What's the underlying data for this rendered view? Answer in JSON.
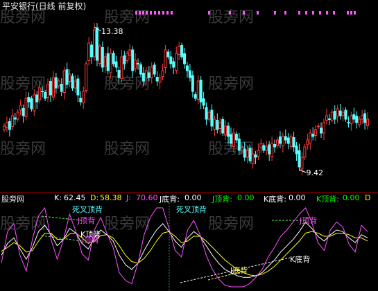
{
  "title": "平安银行(日线 前复权)",
  "watermark": "股旁网",
  "price_panel": {
    "high_label": "13.38",
    "low_label": "9.42"
  },
  "indicator_row": {
    "name": "股旁网",
    "k_label": "K:",
    "k_value": "62.45",
    "d_label": "D:",
    "d_value": "58.38",
    "j_label": "J:",
    "j_value": "70.60",
    "jdibei_label": "J底背:",
    "jdibei_value": "0.00",
    "jdingbei_label": "J顶背:",
    "jdingbei_value": "0.00",
    "kdibei_label": "K底背:",
    "kdibei_value": "0.00",
    "kdingbei_label": "K顶背:",
    "kdingbei_value": "0.00",
    "d_tail": "D"
  },
  "annotations": {
    "sicha_1": "死叉顶背",
    "jdingbei_1": "J顶背",
    "kdingbei_1": "K顶背",
    "jdingbei_2": "J顶背",
    "sicha_2": "死叉顶背",
    "jdingbei_3": "J顶背",
    "kdibei": "K底背",
    "jdibei": "J底背"
  },
  "colors": {
    "up": "#ff3c3c",
    "down": "#54ffff",
    "k": "#ffffff",
    "d": "#ffff00",
    "j": "#ff55ff",
    "grid": "#b00000",
    "label_green": "#00ff00",
    "label_yellow": "#ffff00",
    "label_cyan": "#54ffff",
    "label_magenta": "#ff55ff"
  },
  "chart_data": [
    {
      "type": "candlestick",
      "title": "平安银行(日线 前复权)",
      "ylim": [
        9.0,
        13.8
      ],
      "close": [
        10.6,
        10.7,
        10.5,
        10.9,
        10.8,
        11.0,
        11.2,
        10.9,
        11.4,
        11.3,
        11.1,
        11.5,
        11.3,
        11.7,
        11.6,
        11.4,
        11.8,
        11.5,
        12.0,
        11.7,
        11.9,
        11.6,
        12.2,
        11.8,
        12.1,
        11.7,
        11.9,
        11.5,
        11.3,
        11.6,
        12.4,
        13.0,
        12.6,
        13.38,
        12.5,
        12.9,
        12.3,
        12.6,
        12.2,
        12.7,
        12.4,
        12.3,
        12.0,
        12.6,
        12.4,
        12.7,
        12.8,
        12.2,
        12.5,
        12.4,
        12.1,
        11.9,
        12.2,
        12.0,
        12.3,
        12.1,
        11.9,
        12.0,
        12.2,
        12.8,
        12.6,
        12.4,
        12.3,
        12.7,
        12.9,
        12.6,
        12.4,
        12.2,
        12.0,
        11.6,
        11.4,
        11.9,
        11.3,
        11.2,
        10.8,
        11.0,
        10.6,
        10.8,
        10.5,
        10.7,
        10.4,
        10.6,
        10.3,
        10.1,
        10.4,
        10.2,
        9.9,
        10.0,
        9.7,
        9.9,
        9.6,
        9.8,
        9.7,
        9.9,
        10.1,
        9.9,
        10.0,
        9.8,
        10.1,
        10.0,
        10.2,
        10.1,
        10.3,
        10.2,
        10.1,
        10.3,
        10.0,
        9.8,
        9.42,
        9.7,
        10.0,
        10.2,
        10.4,
        10.3,
        10.5,
        10.6,
        10.4,
        10.7,
        10.9,
        10.8,
        11.0,
        10.8,
        11.1,
        10.9,
        11.0,
        10.8,
        10.7,
        10.9,
        10.8,
        10.7,
        10.8,
        10.9,
        10.7,
        10.8
      ],
      "high_label": "13.38",
      "low_label": "9.42"
    },
    {
      "type": "line",
      "series": [
        {
          "name": "K",
          "values": [
            40,
            55,
            62,
            48,
            35,
            50,
            70,
            78,
            66,
            52,
            60,
            74,
            68,
            55,
            48,
            62,
            72,
            66,
            58,
            40,
            28,
            22,
            30,
            46,
            60,
            72,
            80,
            70,
            58,
            50,
            62,
            70,
            64,
            52,
            40,
            30,
            22,
            18,
            14,
            12,
            12,
            14,
            18,
            26,
            34,
            44,
            52,
            60,
            70,
            82,
            74,
            64,
            58,
            66,
            72,
            70,
            62,
            56,
            66,
            62
          ]
        },
        {
          "name": "D",
          "values": [
            45,
            50,
            56,
            52,
            44,
            46,
            58,
            68,
            68,
            60,
            60,
            67,
            68,
            62,
            55,
            58,
            65,
            66,
            62,
            52,
            40,
            32,
            30,
            36,
            46,
            58,
            68,
            70,
            64,
            56,
            58,
            64,
            64,
            58,
            50,
            42,
            34,
            28,
            22,
            18,
            15,
            14,
            16,
            20,
            26,
            34,
            42,
            50,
            58,
            68,
            70,
            68,
            64,
            64,
            68,
            68,
            66,
            62,
            62,
            58
          ]
        },
        {
          "name": "J",
          "values": [
            30,
            70,
            80,
            40,
            20,
            60,
            90,
            100,
            60,
            35,
            60,
            92,
            70,
            42,
            34,
            72,
            88,
            68,
            50,
            18,
            8,
            4,
            30,
            66,
            88,
            100,
            100,
            74,
            46,
            38,
            72,
            84,
            66,
            40,
            22,
            10,
            2,
            0,
            0,
            0,
            4,
            12,
            22,
            38,
            50,
            64,
            72,
            82,
            92,
            100,
            82,
            56,
            46,
            72,
            82,
            76,
            54,
            44,
            78,
            70
          ]
        }
      ],
      "k_value": 62.45,
      "d_value": 58.38,
      "j_value": 70.6
    }
  ]
}
